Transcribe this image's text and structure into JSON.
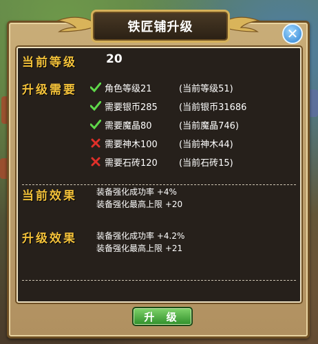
{
  "dialog": {
    "title": "铁匠铺升级",
    "close_icon": "close-icon"
  },
  "current_level": {
    "label": "当前等级",
    "value": "20"
  },
  "requirements": {
    "label": "升级需要",
    "items": [
      {
        "met": true,
        "name": "角色等级21",
        "current": "(当前等级51)"
      },
      {
        "met": true,
        "name": "需要银币285",
        "current": "(当前银币31686"
      },
      {
        "met": true,
        "name": "需要魔晶80",
        "current": "(当前魔晶746)"
      },
      {
        "met": false,
        "name": "需要神木100",
        "current": "(当前神木44)"
      },
      {
        "met": false,
        "name": "需要石砖120",
        "current": "(当前石砖15)"
      }
    ]
  },
  "current_effect": {
    "label": "当前效果",
    "lines": [
      "装备强化成功率 +4%",
      "装备强化最高上限 +20"
    ]
  },
  "upgrade_effect": {
    "label": "升级效果",
    "lines": [
      "装备强化成功率 +4.2%",
      "装备强化最高上限 +21"
    ]
  },
  "upgrade_button": {
    "label": "升 级"
  },
  "colors": {
    "section_title": "#f3c13a",
    "check": "#5fd84a",
    "cross": "#e0302a",
    "panel_bg": "#26201b",
    "button_green": "#2f8f2a"
  }
}
